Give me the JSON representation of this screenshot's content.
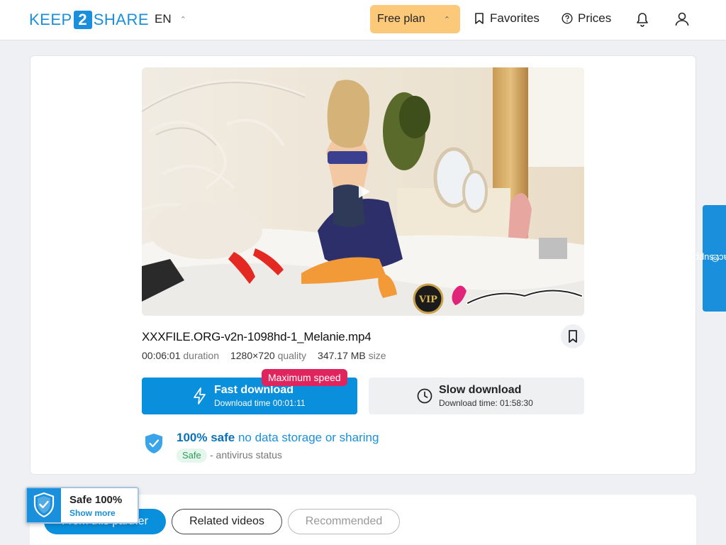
{
  "header": {
    "logo": {
      "left": "KEEP",
      "digit": "2",
      "right": "SHARE"
    },
    "language": "EN",
    "plan_label": "Free plan",
    "favorites_label": "Favorites",
    "prices_label": "Prices"
  },
  "file": {
    "name": "XXXFILE.ORG-v2n-1098hd-1_Melanie.mp4",
    "duration_value": "00:06:01",
    "duration_label": "duration",
    "quality_value": "1280×720",
    "quality_label": "quality",
    "size_value": "347.17 MB",
    "size_label": "size"
  },
  "fast_download": {
    "title": "Fast download",
    "subtitle": "Download time 00:01:11",
    "badge": "Maximum speed"
  },
  "slow_download": {
    "title": "Slow download",
    "subtitle": "Download time: 01:58:30"
  },
  "safety": {
    "headline_strong": "100% safe",
    "headline_rest": "no data storage or sharing",
    "chip": "Safe",
    "status": "- antivirus status"
  },
  "tabs": [
    {
      "label": "From this partner"
    },
    {
      "label": "Related videos"
    },
    {
      "label": "Recommended"
    }
  ],
  "safe_popup": {
    "title": "Safe 100%",
    "more": "Show more"
  },
  "support_label": "contact support",
  "colors": {
    "accent": "#0a8fdc",
    "plan": "#fcc97a",
    "badge": "#e0245e"
  }
}
